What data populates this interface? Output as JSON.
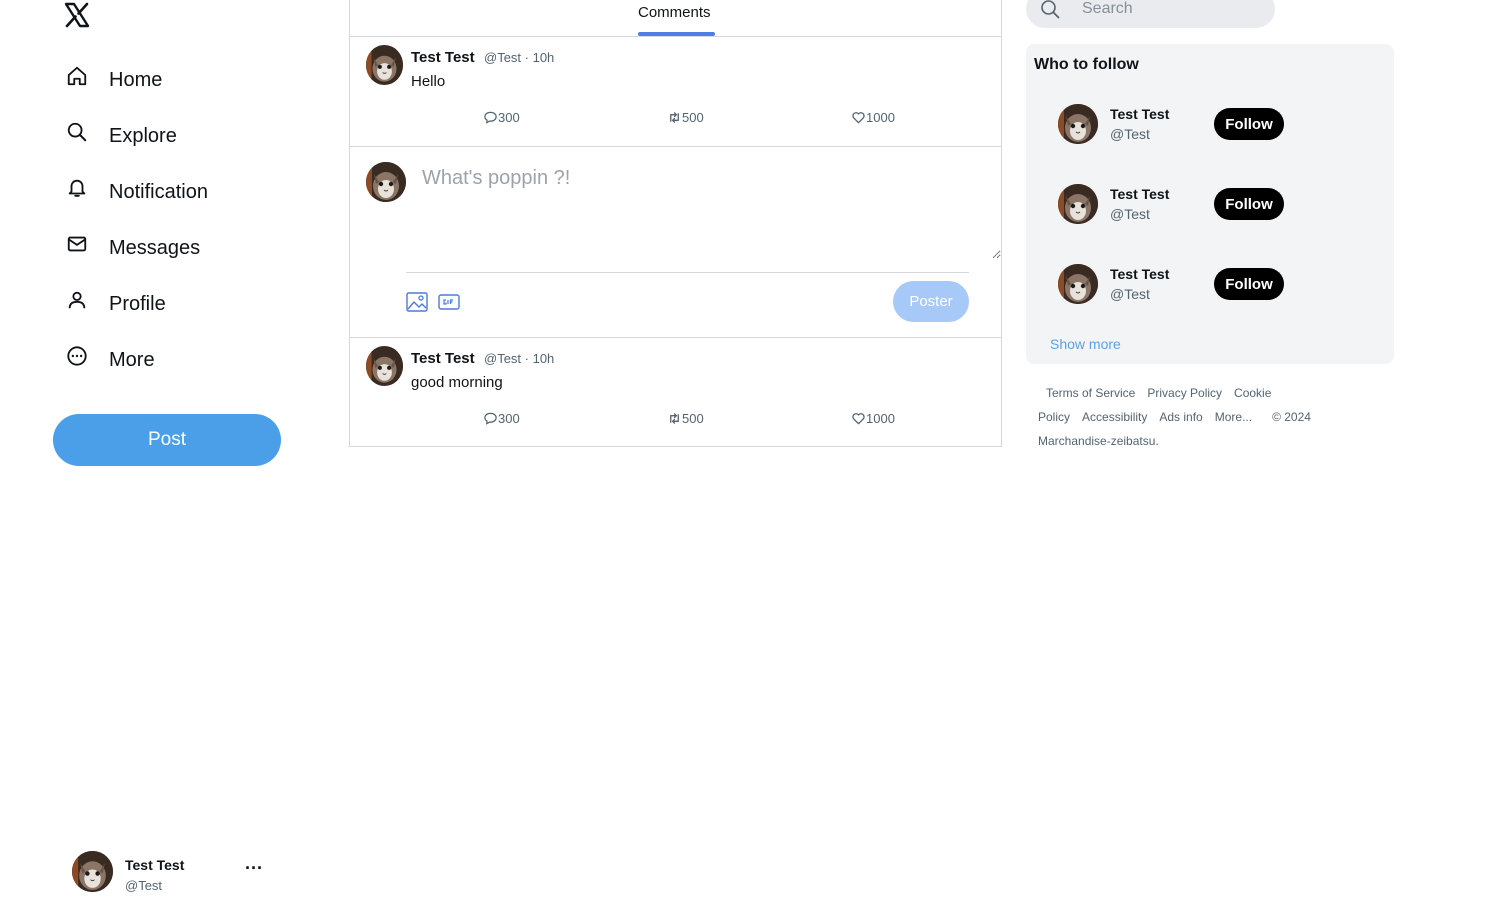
{
  "brand": {
    "logo_icon": "x-logo-icon"
  },
  "nav": {
    "items": [
      {
        "label": "Home",
        "icon": "home-icon"
      },
      {
        "label": "Explore",
        "icon": "search-icon"
      },
      {
        "label": "Notification",
        "icon": "bell-icon"
      },
      {
        "label": "Messages",
        "icon": "mail-icon"
      },
      {
        "label": "Profile",
        "icon": "person-icon"
      },
      {
        "label": "More",
        "icon": "more-circle-icon"
      }
    ],
    "post_label": "Post"
  },
  "account": {
    "name": "Test Test",
    "handle": "@Test",
    "more": "···"
  },
  "tabs": {
    "active": "Comments"
  },
  "tweets": [
    {
      "name": "Test Test",
      "meta": "@Test · 10h",
      "text": "Hello",
      "replies": "300",
      "retweets": "500",
      "likes": "1000"
    },
    {
      "name": "Test Test",
      "meta": "@Test · 10h",
      "text": "good morning",
      "replies": "300",
      "retweets": "500",
      "likes": "1000"
    }
  ],
  "composer": {
    "placeholder": "What's poppin ?!",
    "submit_label": "Poster"
  },
  "search": {
    "placeholder": "Search"
  },
  "who_to_follow": {
    "title": "Who to follow",
    "users": [
      {
        "name": "Test Test",
        "handle": "@Test",
        "button": "Follow"
      },
      {
        "name": "Test Test",
        "handle": "@Test",
        "button": "Follow"
      },
      {
        "name": "Test Test",
        "handle": "@Test",
        "button": "Follow"
      }
    ],
    "show_more": "Show more"
  },
  "footer": {
    "terms": "Terms of Service",
    "privacy": "Privacy Policy",
    "cookie_a": "Cookie",
    "cookie_b": "Policy",
    "accessibility": "Accessibility",
    "ads": "Ads info",
    "more": "More...",
    "copyright": "© 2024",
    "company": "Marchandise-zeibatsu."
  },
  "colors": {
    "accent": "#4a9fe8",
    "tab_underline": "#4f7fe0",
    "poster_disabled": "#a6c9f7",
    "panel_bg": "#f3f4f6"
  }
}
